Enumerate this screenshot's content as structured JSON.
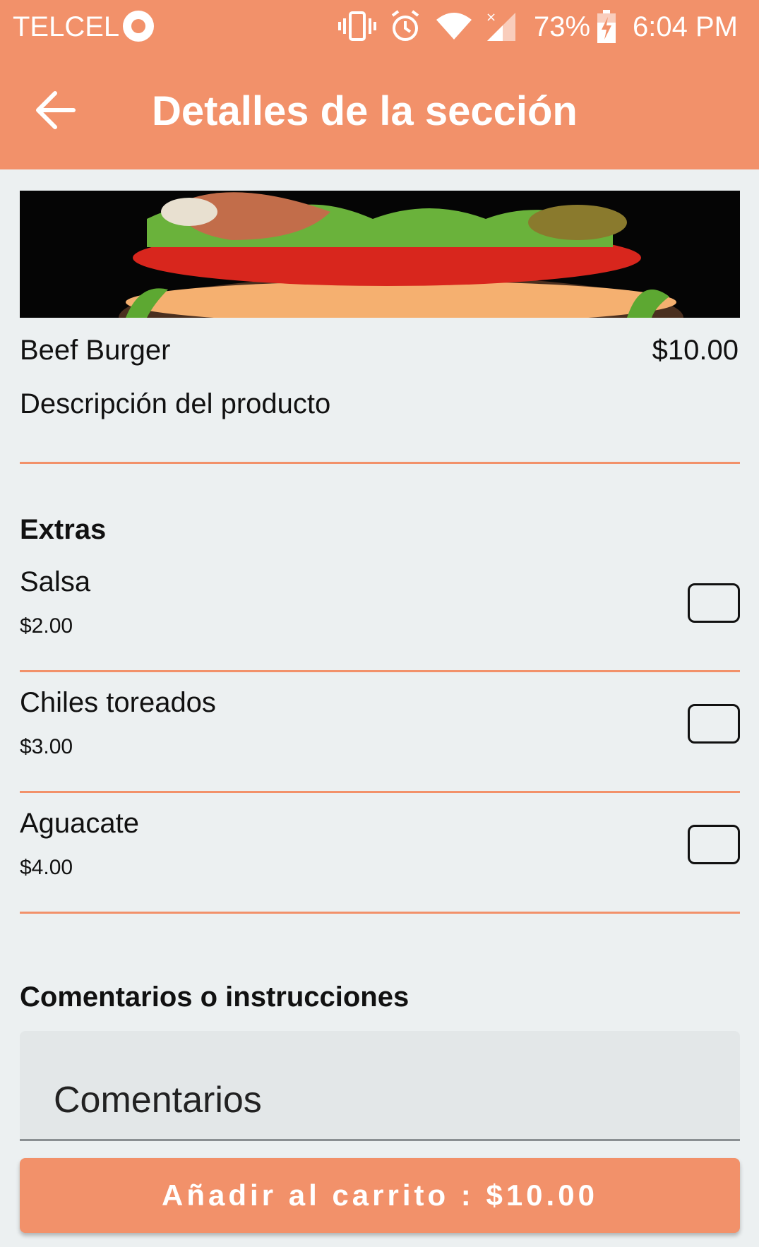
{
  "status_bar": {
    "carrier": "TELCEL",
    "battery_percent": "73%",
    "time": "6:04 PM",
    "icons": [
      "record-icon",
      "vibrate-icon",
      "alarm-icon",
      "wifi-icon",
      "signal-icon",
      "battery-charging-icon"
    ]
  },
  "header": {
    "title": "Detalles de la sección",
    "back_icon": "arrow-left-icon",
    "background_color": "#f2916a"
  },
  "product": {
    "image": "burger-photo",
    "name": "Beef Burger",
    "price": "$10.00",
    "description": "Descripción del producto"
  },
  "extras": {
    "title": "Extras",
    "items": [
      {
        "name": "Salsa",
        "price": "$2.00",
        "checked": false
      },
      {
        "name": "Chiles toreados",
        "price": "$3.00",
        "checked": false
      },
      {
        "name": "Aguacate",
        "price": "$4.00",
        "checked": false
      }
    ]
  },
  "comments": {
    "title": "Comentarios o instrucciones",
    "placeholder": "Comentarios"
  },
  "cart_button": {
    "label": "Añadir al carrito : $10.00"
  },
  "colors": {
    "accent": "#f2916a",
    "background": "#ecf0f1"
  }
}
